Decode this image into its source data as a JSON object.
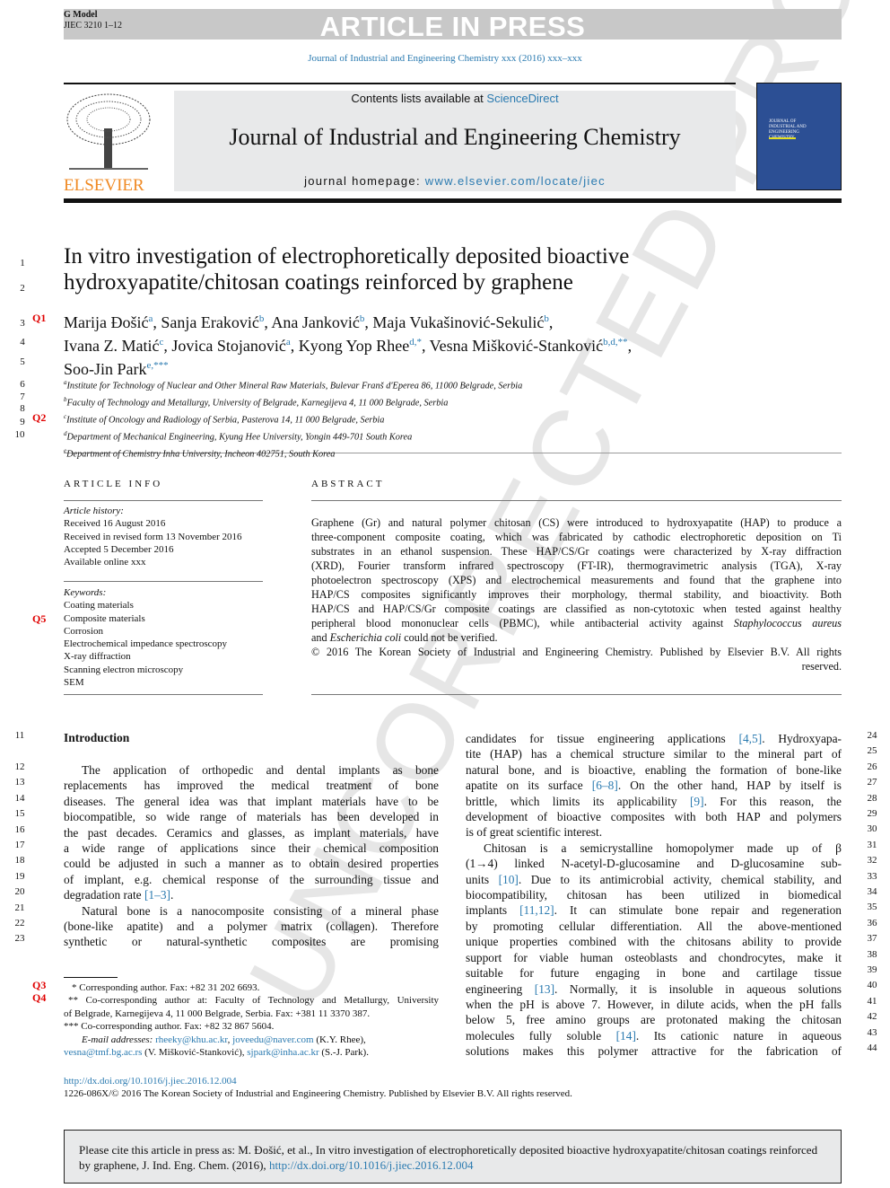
{
  "banner": {
    "text": "ARTICLE IN PRESS",
    "model": "G Model",
    "ref": "JIEC 3210 1–12"
  },
  "journal_ref": "Journal of Industrial and Engineering Chemistry xxx (2016) xxx–xxx",
  "header": {
    "contents_prefix": "Contents lists available at ",
    "contents_link": "ScienceDirect",
    "journal_title": "Journal of Industrial and Engineering Chemistry",
    "homepage_prefix": "journal homepage: ",
    "homepage_link": "www.elsevier.com/locate/jiec",
    "publisher": "ELSEVIER",
    "cover_title": "Journal of Industrial and Engineering Chemistry"
  },
  "watermark": "UNCORRECTED PROOF",
  "title_lines": [
    "In vitro investigation of electrophoretically deposited bioactive",
    "hydroxyapatite/chitosan coatings reinforced by graphene"
  ],
  "authors": [
    [
      [
        "Marija Đošić",
        "a"
      ],
      [
        ", Sanja Eraković",
        "b"
      ],
      [
        ", Ana Janković",
        "b"
      ],
      [
        ", Maja Vukašinović-Sekulić",
        "b"
      ],
      [
        ",",
        ""
      ]
    ],
    [
      [
        "Ivana Z. Matić",
        "c"
      ],
      [
        ", Jovica Stojanović",
        "a"
      ],
      [
        ", Kyong Yop Rhee",
        "d,*"
      ],
      [
        ", Vesna Mišković-Stanković",
        "b,d,**"
      ],
      [
        ",",
        ""
      ]
    ],
    [
      [
        "Soo-Jin Park",
        "e,***"
      ]
    ]
  ],
  "affiliations": [
    [
      "a",
      "Institute for Technology of Nuclear and Other Mineral Raw Materials, Bulevar Franš d'Eperea 86, 11000 Belgrade, Serbia"
    ],
    [
      "b",
      "Faculty of Technology and Metallurgy, University of Belgrade, Karnegijeva 4, 11 000 Belgrade, Serbia"
    ],
    [
      "c",
      "Institute of Oncology and Radiology of Serbia, Pasterova 14, 11 000 Belgrade, Serbia"
    ],
    [
      "d",
      "Department of Mechanical Engineering, Kyung Hee University, Yongin 449-701 South Korea"
    ],
    [
      "e",
      "Department of Chemistry Inha University, Incheon 402751, South Korea"
    ]
  ],
  "line_numbers_top": [
    "1",
    "2",
    "3",
    "4",
    "5",
    "6",
    "7",
    "8",
    "9",
    "10"
  ],
  "queries": {
    "q1": "Q1",
    "q2": "Q2",
    "q3": "Q3",
    "q4": "Q4",
    "q5": "Q5"
  },
  "article_info": {
    "heading": "ARTICLE INFO",
    "history_label": "Article history:",
    "history": [
      "Received 16 August 2016",
      "Received in revised form 13 November 2016",
      "Accepted 5 December 2016",
      "Available online xxx"
    ],
    "keywords_label": "Keywords:",
    "keywords": [
      "Coating materials",
      "Composite materials",
      "Corrosion",
      "Electrochemical impedance spectroscopy",
      "X-ray diffraction",
      "Scanning electron microscopy",
      "SEM"
    ]
  },
  "abstract": {
    "heading": "ABSTRACT",
    "lines": [
      "Graphene (Gr) and natural polymer chitosan (CS) were introduced to hydroxyapatite (HAP) to produce a",
      "three-component composite coating, which was fabricated by cathodic electrophoretic deposition on Ti",
      "substrates in an ethanol suspension. These HAP/CS/Gr coatings were characterized by X-ray diffraction",
      "(XRD), Fourier transform infrared spectroscopy (FT-IR), thermogravimetric analysis (TGA), X-ray",
      "photoelectron spectroscopy (XPS) and electrochemical measurements and found that the graphene into",
      "HAP/CS composites significantly improves their morphology, thermal stability, and bioactivity. Both",
      "HAP/CS and HAP/CS/Gr composite coatings are classified as non-cytotoxic when tested against healthy",
      "peripheral blood mononuclear cells (PBMC), while antibacterial activity against _Staphylococcus aureus_",
      "and _Escherichia coli_ could not be verified.",
      "© 2016 The Korean Society of Industrial and Engineering Chemistry. Published by Elsevier B.V. All rights",
      "reserved."
    ]
  },
  "intro": {
    "heading": "Introduction",
    "left_lines": [
      "The application of orthopedic and dental implants as bone",
      "replacements has improved the medical treatment of bone",
      "diseases. The general idea was that implant materials have to be",
      "biocompatible, so wide range of materials has been developed in",
      "the past decades. Ceramics and glasses, as implant materials, have",
      "a wide range of applications since their chemical composition",
      "could be adjusted in such a manner as to obtain desired properties",
      "of implant, e.g. chemical response of the surrounding tissue and",
      "degradation rate [1–3].",
      "Natural bone is a nanocomposite consisting of a mineral phase",
      "(bone-like apatite) and a polymer matrix (collagen). Therefore",
      "synthetic or natural-synthetic composites are promising"
    ],
    "left_numbers": [
      "12",
      "13",
      "14",
      "15",
      "16",
      "17",
      "18",
      "19",
      "20",
      "21",
      "22",
      "23"
    ],
    "right_lines": [
      "candidates for tissue engineering applications [4,5]. Hydroxyapa-",
      "tite (HAP) has a chemical structure similar to the mineral part of",
      "natural bone, and is bioactive, enabling the formation of bone-like",
      "apatite on its surface [6–8]. On the other hand, HAP by itself is",
      "brittle, which limits its applicability [9]. For this reason, the",
      "development of bioactive composites with both HAP and polymers",
      "is of great scientific interest.",
      "Chitosan is a semicrystalline homopolymer made up of β",
      "(1→4) linked N-acetyl-D-glucosamine and D-glucosamine sub-",
      "units [10]. Due to its antimicrobial activity, chemical stability, and",
      "biocompatibility, chitosan has been utilized in biomedical",
      "implants [11,12]. It can stimulate bone repair and regeneration",
      "by promoting cellular differentiation. All the above-mentioned",
      "unique properties combined with the chitosans ability to provide",
      "support for viable human osteoblasts and chondrocytes, make it",
      "suitable for future engaging in bone and cartilage tissue",
      "engineering [13]. Normally, it is insoluble in aqueous solutions",
      "when the pH is above 7. However, in dilute acids, when the pH falls",
      "below 5, free amino groups are protonated making the chitosan",
      "molecules fully soluble [14]. Its cationic nature in aqueous",
      "solutions makes this polymer attractive for the fabrication of"
    ],
    "right_numbers": [
      "24",
      "25",
      "26",
      "27",
      "28",
      "29",
      "30",
      "31",
      "32",
      "33",
      "34",
      "35",
      "36",
      "37",
      "38",
      "39",
      "40",
      "41",
      "42",
      "43",
      "44"
    ],
    "heading_number": "11"
  },
  "footnotes": {
    "f1": "Corresponding author. Fax: +82 31 202 6693.",
    "f2a": "Co-corresponding author at: Faculty of Technology and Metallurgy, University",
    "f2b": "of Belgrade, Karnegijeva 4, 11 000 Belgrade, Serbia. Fax: +381 11 3370 387.",
    "f3": "Co-corresponding author. Fax: +82 32 867 5604.",
    "email_label": "E-mail addresses:",
    "email1": "rheeky@khu.ac.kr",
    "email2": "joveedu@naver.com",
    "owner12": " (K.Y. Rhee),",
    "email3": "vesna@tmf.bg.ac.rs",
    "owner3": " (V. Mišković-Stanković), ",
    "email4": "sjpark@inha.ac.kr",
    "owner4": " (S.-J. Park)."
  },
  "doi": "http://dx.doi.org/10.1016/j.jiec.2016.12.004",
  "copyright": "1226-086X/© 2016 The Korean Society of Industrial and Engineering Chemistry. Published by Elsevier B.V. All rights reserved.",
  "cite": {
    "text": "Please cite this article in press as: M. Đošić, et al., In vitro investigation of electrophoretically deposited bioactive hydroxyapatite/chitosan coatings reinforced by graphene, J. Ind. Eng. Chem. (2016), ",
    "link": "http://dx.doi.org/10.1016/j.jiec.2016.12.004"
  },
  "colors": {
    "link": "#2a7ab0",
    "query": "#e00000",
    "banner": "#c8c8c8",
    "header_bg": "#e8e9ea",
    "elsevier": "#f08a24",
    "cover": "#2c4f94"
  }
}
